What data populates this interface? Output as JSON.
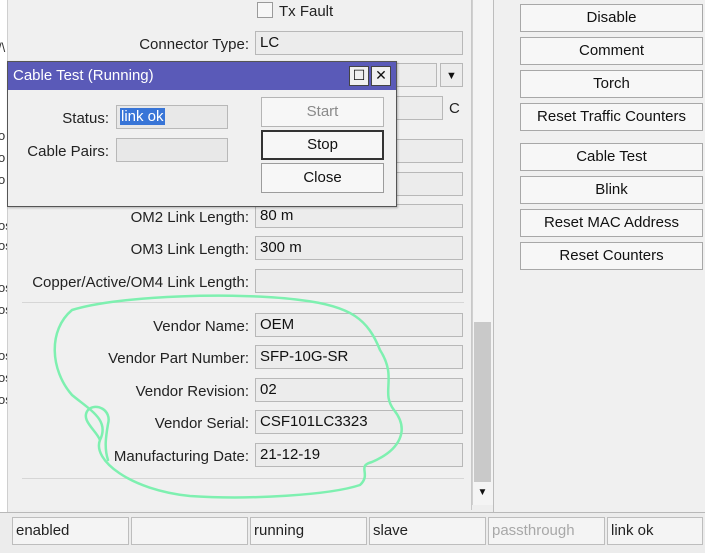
{
  "left_strip": [
    "/\\",
    "o",
    "o",
    "o",
    "os",
    "os",
    "os",
    "os",
    "os",
    "os",
    "os"
  ],
  "main": {
    "tx_fault_label": "Tx Fault",
    "fields": [
      {
        "label": "Connector Type:",
        "value": "LC"
      },
      {
        "label": "",
        "value": ""
      },
      {
        "label": "",
        "value": "",
        "suffix": "C"
      },
      {
        "label": "",
        "value": ""
      },
      {
        "label": "",
        "value": ""
      },
      {
        "label": "OM2 Link Length:",
        "value": "80 m"
      },
      {
        "label": "OM3 Link Length:",
        "value": "300 m"
      },
      {
        "label": "Copper/Active/OM4 Link Length:",
        "value": ""
      },
      {
        "label": "Vendor Name:",
        "value": "OEM"
      },
      {
        "label": "Vendor Part Number:",
        "value": "SFP-10G-SR"
      },
      {
        "label": "Vendor Revision:",
        "value": "02"
      },
      {
        "label": "Vendor Serial:",
        "value": "CSF101LC3323"
      },
      {
        "label": "Manufacturing Date:",
        "value": "21-12-19"
      }
    ]
  },
  "right_buttons": [
    "Disable",
    "Comment",
    "Torch",
    "Reset Traffic Counters",
    "Cable Test",
    "Blink",
    "Reset MAC Address",
    "Reset Counters"
  ],
  "dialog": {
    "title": "Cable Test (Running)",
    "status_label": "Status:",
    "status_value": "link ok",
    "pairs_label": "Cable Pairs:",
    "pairs_value": "",
    "start_label": "Start",
    "stop_label": "Stop",
    "close_label": "Close",
    "maximize_glyph": "☐",
    "close_glyph": "✕"
  },
  "scroll_down_glyph": "▼",
  "status_bar": [
    "enabled",
    "",
    "running",
    "slave",
    "passthrough",
    "link ok"
  ],
  "colors": {
    "title_bar": "#5a5ab8",
    "selection": "#3875d7",
    "annotation": "#7ef0b0",
    "disabled_text": "#a8a8a8"
  }
}
